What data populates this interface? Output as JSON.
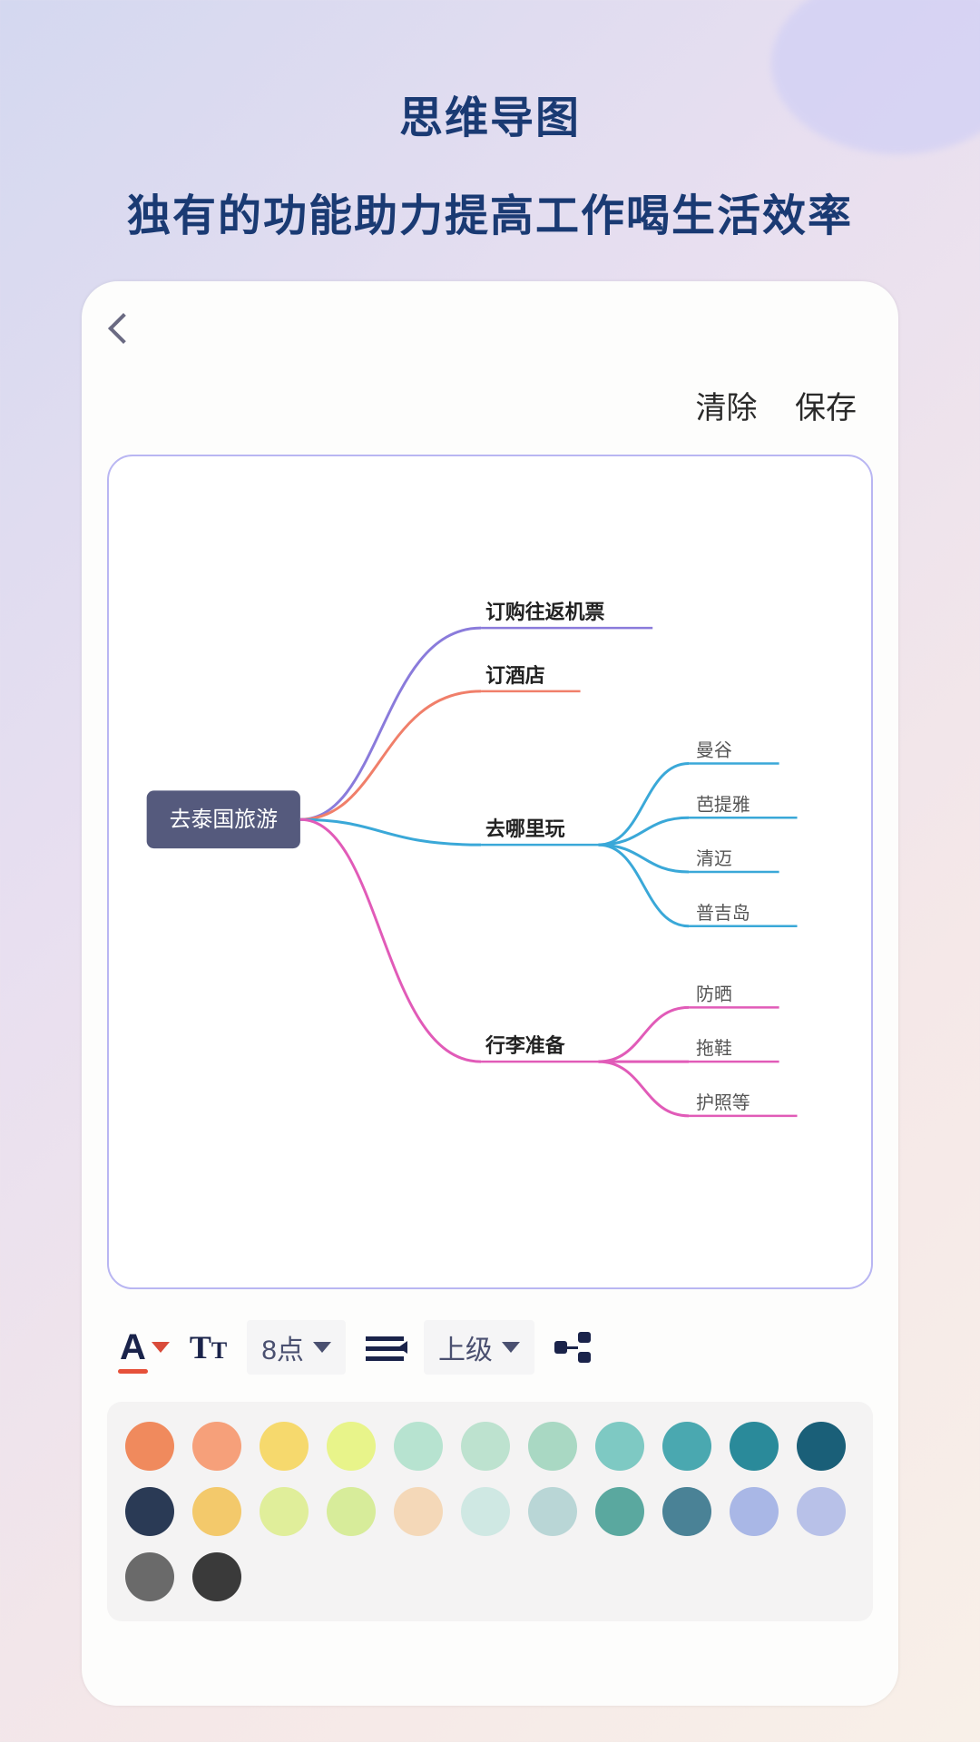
{
  "headline": {
    "line1": "思维导图",
    "line2": "独有的功能助力提高工作喝生活效率"
  },
  "actions": {
    "clear": "清除",
    "save": "保存"
  },
  "mindmap": {
    "root": "去泰国旅游",
    "branches": [
      {
        "label": "订购往返机票",
        "color": "#8a7bdb",
        "children": []
      },
      {
        "label": "订酒店",
        "color": "#f07f6a",
        "children": []
      },
      {
        "label": "去哪里玩",
        "color": "#3aa8d8",
        "children": [
          "曼谷",
          "芭提雅",
          "清迈",
          "普吉岛"
        ]
      },
      {
        "label": "行李准备",
        "color": "#e15bb8",
        "children": [
          "防晒",
          "拖鞋",
          "护照等"
        ]
      }
    ]
  },
  "toolbar": {
    "font_size": "8点",
    "level": "上级"
  },
  "palette_row1": [
    "#f08a5d",
    "#f6a07a",
    "#f6d96d",
    "#e8f48a",
    "#b7e3d0",
    "#bde2cf",
    "#a9d8c3",
    "#7ec9c3",
    "#4aa8b0",
    "#2a8a9a",
    "#1a5f78",
    "#2a3a55"
  ],
  "palette_row2": [
    "#f3c96b",
    "#e0ee9a",
    "#d7ec9a",
    "#f4d8b8",
    "#cfe8e3",
    "#b9d6d6",
    "#5aa89f",
    "#4a8296",
    "#a9b7e6",
    "#b8c1e8",
    "#6a6a6a",
    "#3a3a3a"
  ]
}
